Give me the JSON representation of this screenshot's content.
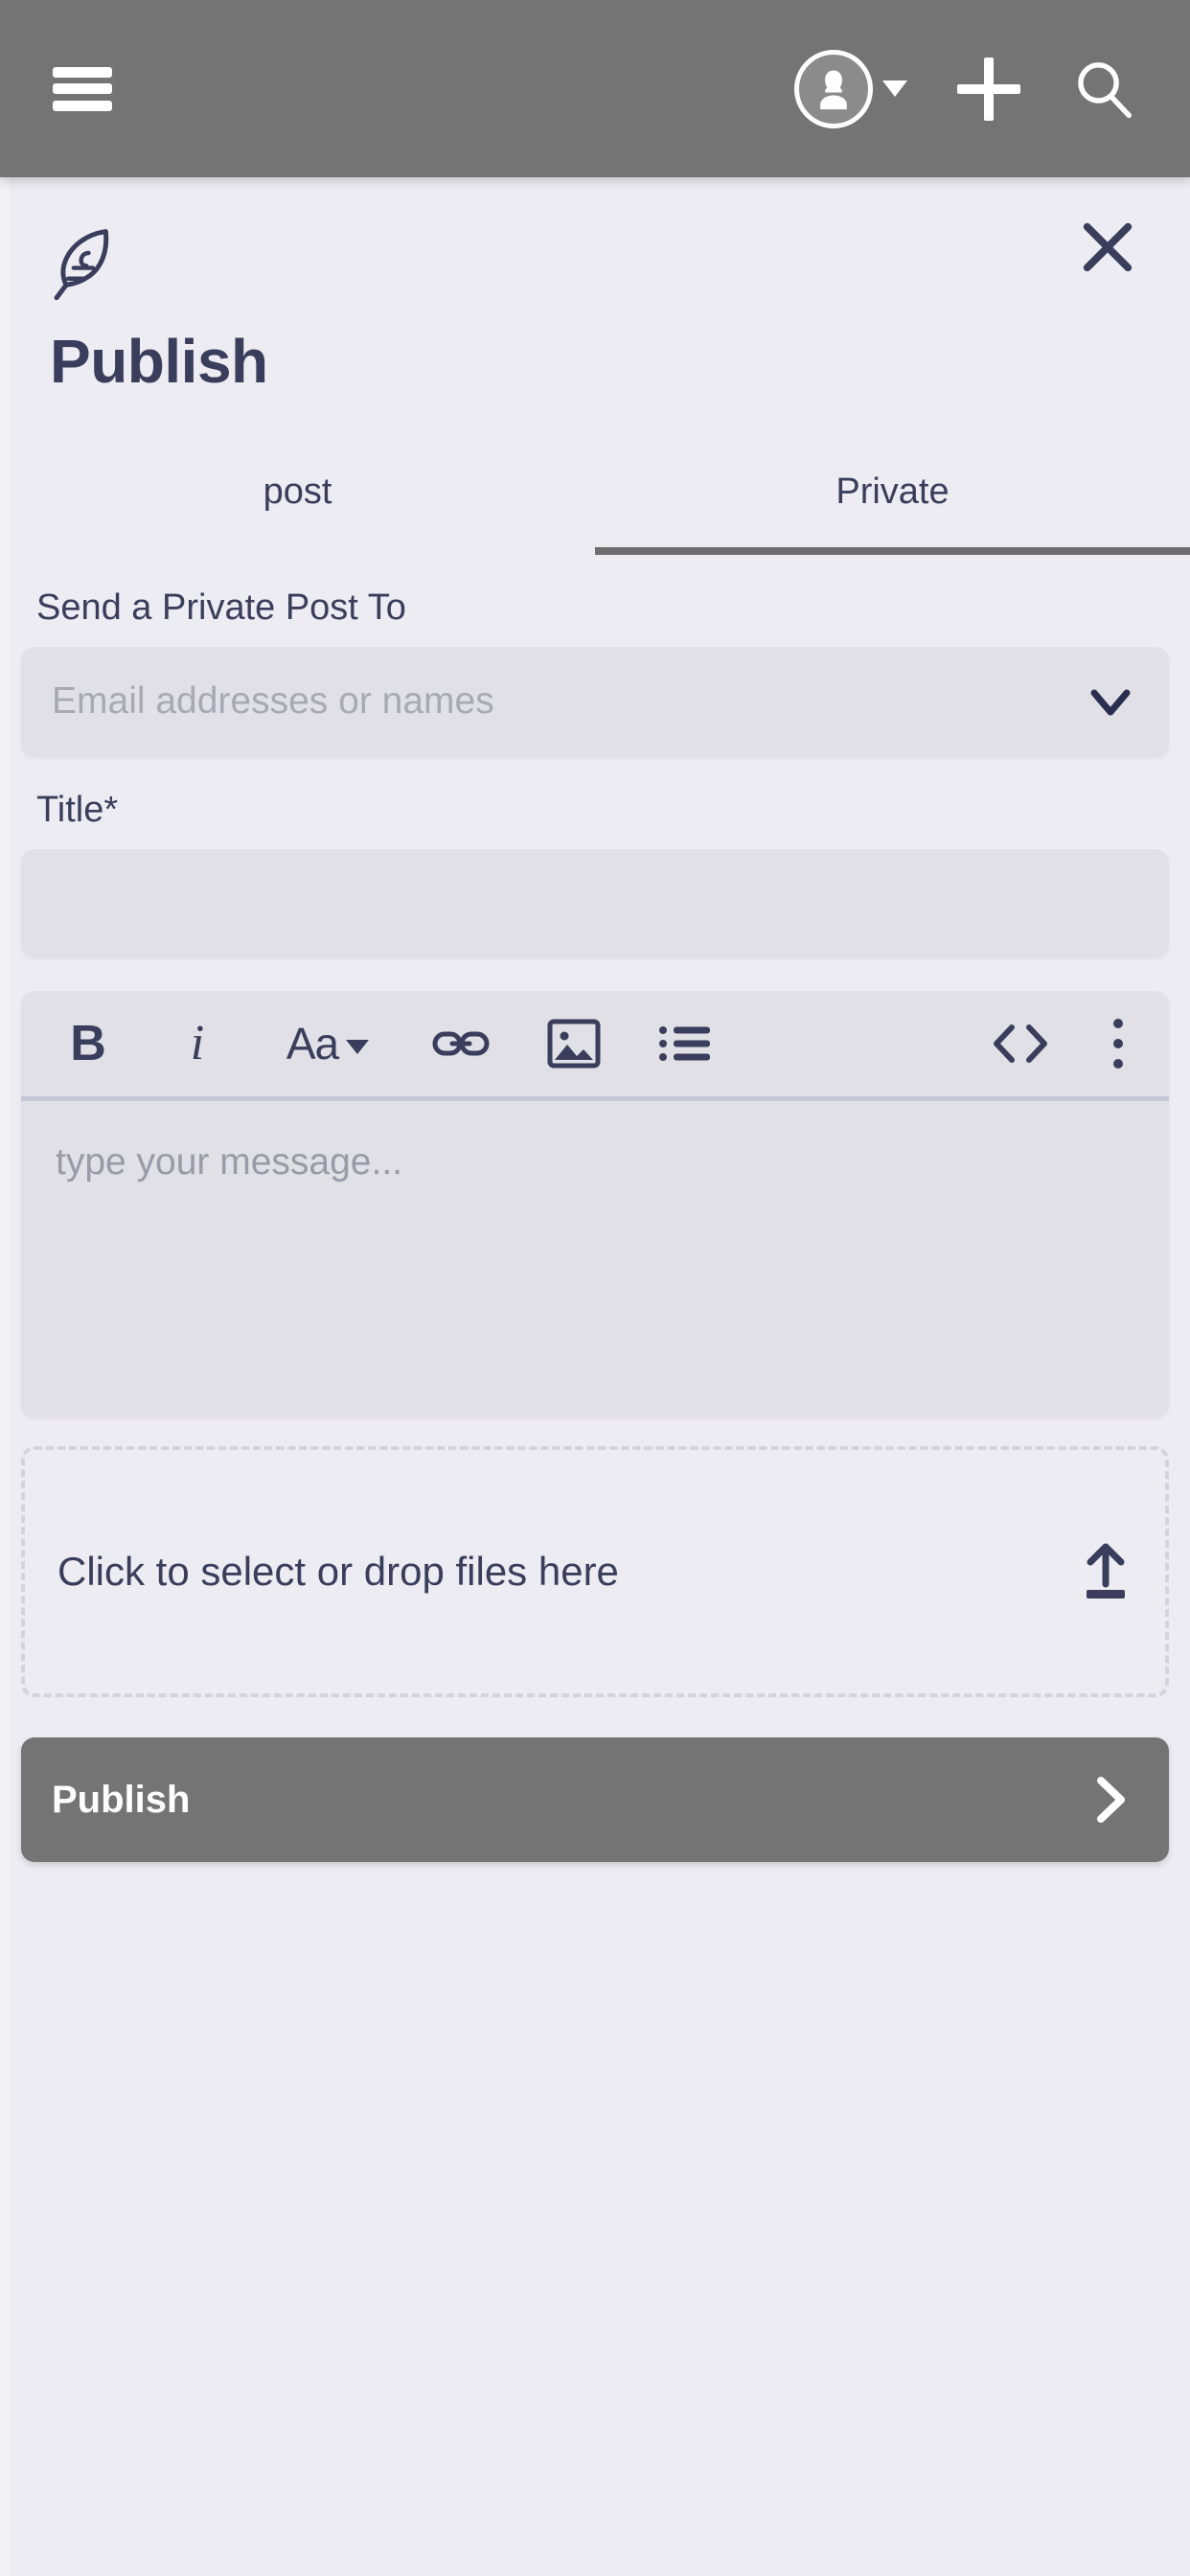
{
  "appbar": {
    "menu_icon": "hamburger-menu-icon",
    "avatar_icon": "user-avatar-icon",
    "avatar_caret_icon": "caret-down-icon",
    "add_icon": "plus-icon",
    "search_icon": "search-icon",
    "background_color": "#747474"
  },
  "panel": {
    "brand_icon": "feather-quill-icon",
    "close_icon": "close-x-icon",
    "title": "Publish",
    "title_color": "#3a3e5c",
    "background_color": "#edecf2"
  },
  "tabs": [
    {
      "label": "post",
      "active": false
    },
    {
      "label": "Private",
      "active": true
    }
  ],
  "form": {
    "recipients": {
      "label": "Send a Private Post To",
      "placeholder": "Email addresses or names",
      "value": "",
      "chevron_icon": "chevron-down-icon"
    },
    "title": {
      "label": "Title*",
      "placeholder": "",
      "value": ""
    }
  },
  "editor": {
    "toolbar": [
      {
        "name": "bold",
        "glyph": "B"
      },
      {
        "name": "italic",
        "glyph": "i"
      },
      {
        "name": "font-size",
        "glyph": "Aa"
      },
      {
        "name": "link",
        "glyph": "link-icon"
      },
      {
        "name": "image",
        "glyph": "image-icon"
      },
      {
        "name": "bullet-list",
        "glyph": "list-icon"
      },
      {
        "name": "code",
        "glyph": "code-icon"
      },
      {
        "name": "more-options",
        "glyph": "kebab-menu-icon"
      }
    ],
    "message_placeholder": "type your message...",
    "message_value": ""
  },
  "dropzone": {
    "text": "Click to select or drop files here",
    "upload_icon": "upload-arrow-icon"
  },
  "publish_button": {
    "label": "Publish",
    "arrow_icon": "chevron-right-icon",
    "background_color": "#747474"
  }
}
